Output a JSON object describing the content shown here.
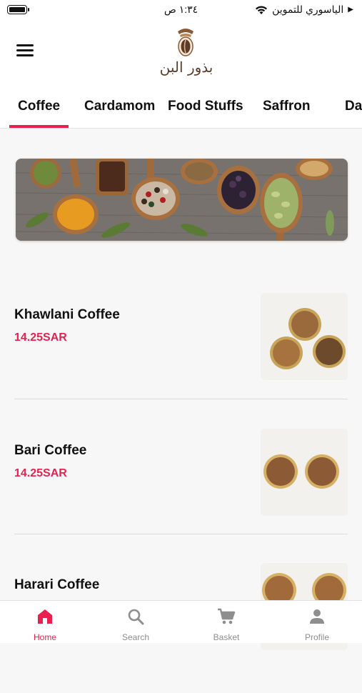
{
  "status_bar": {
    "time": "١:٣٤ ص",
    "carrier": "الياسوري للتموين"
  },
  "header": {
    "logo_text": "بذور البن"
  },
  "tabs": [
    {
      "label": "Coffee",
      "active": true
    },
    {
      "label": "Cardamom",
      "active": false
    },
    {
      "label": "Food Stuffs",
      "active": false
    },
    {
      "label": "Saffron",
      "active": false
    },
    {
      "label": "Dat",
      "active": false
    }
  ],
  "products": [
    {
      "name": "Khawlani Coffee",
      "price": "14.25SAR"
    },
    {
      "name": "Bari Coffee",
      "price": "14.25SAR"
    },
    {
      "name": "Harari Coffee",
      "price": ""
    }
  ],
  "bottom_nav": [
    {
      "label": "Home",
      "icon": "home-icon",
      "active": true
    },
    {
      "label": "Search",
      "icon": "search-icon",
      "active": false
    },
    {
      "label": "Basket",
      "icon": "cart-icon",
      "active": false
    },
    {
      "label": "Profile",
      "icon": "profile-icon",
      "active": false
    }
  ],
  "colors": {
    "accent": "#e8204f",
    "inactive": "#8e8e8e"
  }
}
